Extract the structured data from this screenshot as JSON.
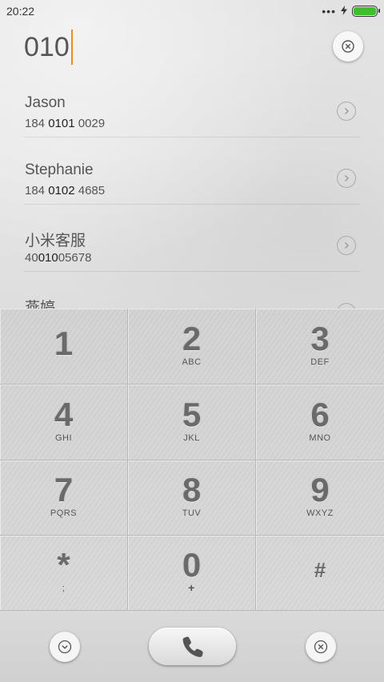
{
  "status_bar": {
    "time": "20:22",
    "signal_dots": "•••",
    "charging_icon": "bolt-icon",
    "battery_color": "#3fbf2e"
  },
  "dialer": {
    "input_value": "010",
    "caret_color": "#f08a1c"
  },
  "contacts": [
    {
      "name": "Jason",
      "number_pre": "184 ",
      "number_match": "0101",
      "number_post": " 0029"
    },
    {
      "name": "Stephanie",
      "number_pre": "184 ",
      "number_match": "0102",
      "number_post": " 4685"
    },
    {
      "name": "小米客服",
      "number_pre": "40",
      "number_match": "010",
      "number_post": "05678"
    },
    {
      "name": "燕婷",
      "number_pre": "",
      "number_match": "",
      "number_post": ""
    }
  ],
  "keypad": [
    {
      "digit": "1",
      "letters": ""
    },
    {
      "digit": "2",
      "letters": "ABC"
    },
    {
      "digit": "3",
      "letters": "DEF"
    },
    {
      "digit": "4",
      "letters": "GHI"
    },
    {
      "digit": "5",
      "letters": "JKL"
    },
    {
      "digit": "6",
      "letters": "MNO"
    },
    {
      "digit": "7",
      "letters": "PQRS"
    },
    {
      "digit": "8",
      "letters": "TUV"
    },
    {
      "digit": "9",
      "letters": "WXYZ"
    },
    {
      "digit": "*",
      "letters": ";"
    },
    {
      "digit": "0",
      "letters": "+"
    },
    {
      "digit": "#",
      "letters": ""
    }
  ],
  "bottom_bar": {
    "collapse_icon": "chevron-down-icon",
    "call_icon": "phone-icon",
    "delete_icon": "close-icon"
  }
}
